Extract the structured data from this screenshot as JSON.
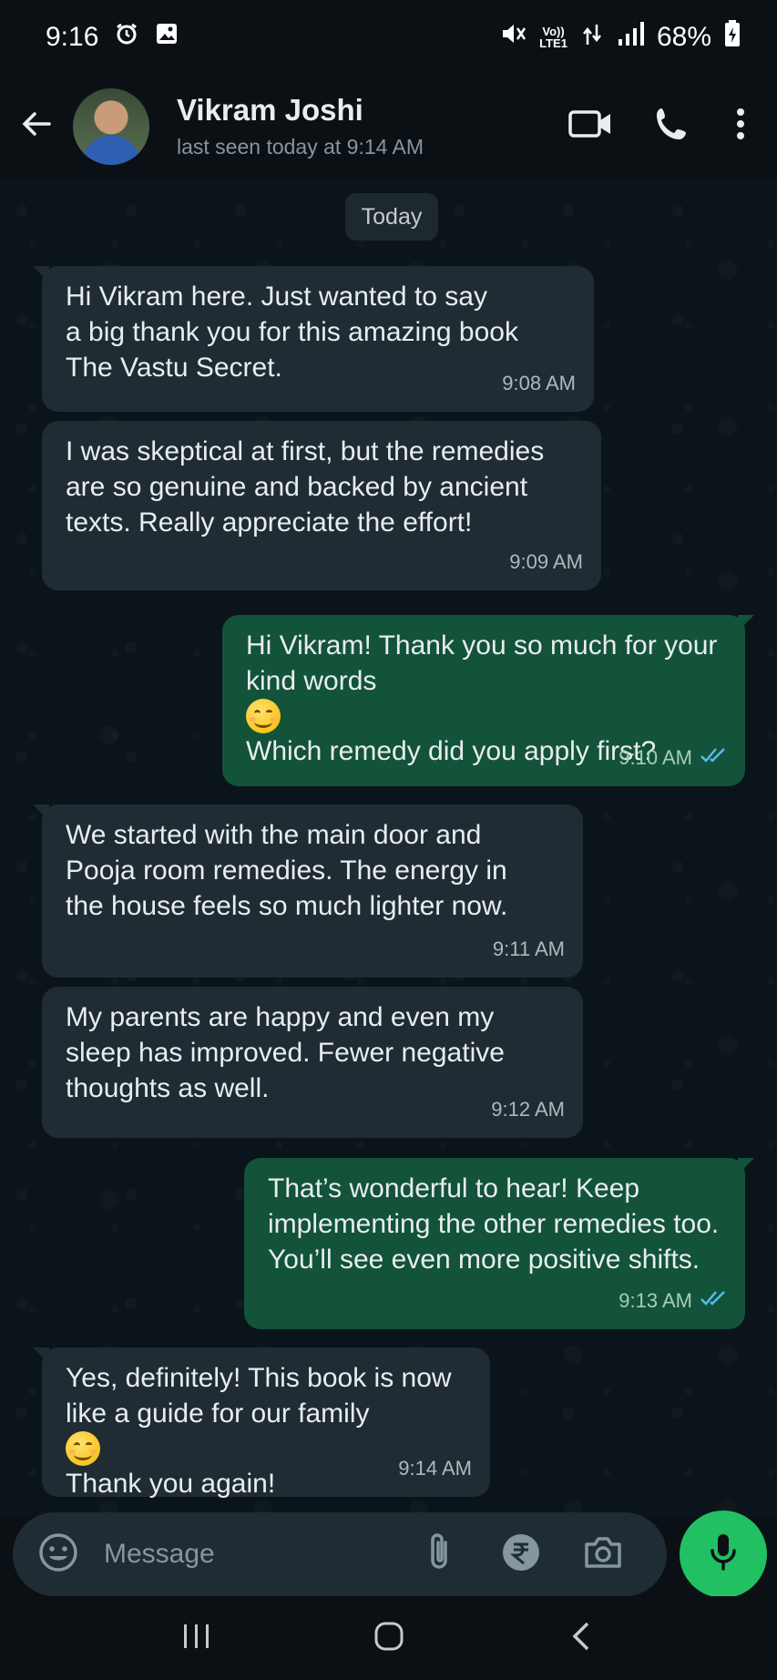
{
  "status_bar": {
    "time": "9:16",
    "network_top": "Vo))",
    "network_bottom": "LTE1",
    "battery": "68%"
  },
  "header": {
    "contact_name": "Vikram Joshi",
    "last_seen": "last seen today at 9:14 AM"
  },
  "date_chip": "Today",
  "messages": [
    {
      "direction": "in",
      "lines": [
        "Hi Vikram here. Just wanted to say",
        "a big thank you for this amazing book",
        "The Vastu Secret."
      ],
      "time": "9:08 AM"
    },
    {
      "direction": "in",
      "lines": [
        "I was skeptical at first, but the remedies",
        "are so genuine and backed by ancient",
        "texts. Really appreciate the effort!"
      ],
      "time": "9:09 AM"
    },
    {
      "direction": "out",
      "lines": [
        "Hi Vikram! Thank you so much for your",
        "kind words",
        "Which remedy did you apply first?"
      ],
      "time": "9:10 AM",
      "status": "read"
    },
    {
      "direction": "in",
      "lines": [
        "We started with the main door and",
        "Pooja room remedies. The energy in",
        "the house feels so much lighter now."
      ],
      "time": "9:11 AM"
    },
    {
      "direction": "in",
      "lines": [
        "My parents are happy and even my",
        "sleep has improved. Fewer negative",
        "thoughts as well."
      ],
      "time": "9:12 AM"
    },
    {
      "direction": "out",
      "lines": [
        "That’s wonderful to hear! Keep",
        "implementing the other remedies too.",
        "You’ll see even more positive shifts."
      ],
      "time": "9:13 AM",
      "status": "read"
    },
    {
      "direction": "in",
      "lines": [
        "Yes, definitely! This book is now",
        "like a guide for our family",
        "Thank you again!"
      ],
      "time": "9:14 AM"
    }
  ],
  "input": {
    "placeholder": "Message"
  },
  "colors": {
    "incoming_bubble": "#1f2c33",
    "outgoing_bubble": "#12533a",
    "accent_green": "#21c063",
    "read_ticks": "#53bdeb"
  },
  "icons": [
    "back-arrow-icon",
    "video-call-icon",
    "voice-call-icon",
    "more-options-icon",
    "emoji-icon",
    "attach-icon",
    "rupee-payment-icon",
    "camera-icon",
    "mic-icon"
  ]
}
